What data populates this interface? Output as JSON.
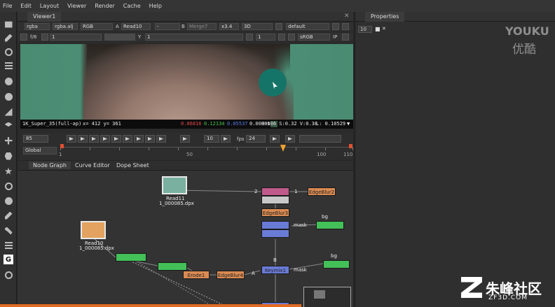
{
  "menu": [
    "File",
    "Edit",
    "Layout",
    "Viewer",
    "Render",
    "Cache",
    "Help"
  ],
  "viewer": {
    "tab": "Viewer1",
    "row1": {
      "channels": "rgba",
      "alpha": "rgba.alj",
      "colorspace": "RGB",
      "a_label": "A",
      "a_input": "Read10",
      "dash": "-",
      "b_label": "B",
      "b_input": "Merge7",
      "zoom": "x3.4",
      "mode": "3D",
      "lut": "default"
    },
    "row2": {
      "fstop": "f/8",
      "gain": "1",
      "y_label": "Y",
      "gamma": "1",
      "frame": "1",
      "display": "sRGB",
      "ip": "IP"
    },
    "info": {
      "format": "1K_Super_35(full-ap)",
      "coords": "x= 412 y= 361",
      "r": "0.06816",
      "g": "0.12134",
      "b": "0.05537",
      "a": "0.00000",
      "hsv": "H:106 S:0.32 V:0.38",
      "lum": "L: 0.10529"
    },
    "timeline": {
      "frame": "85",
      "step": "10",
      "fps_label": "fps",
      "fps": "24",
      "scope": "Global",
      "ruler": [
        "1",
        "50",
        "100",
        "110"
      ],
      "range_end": "110"
    }
  },
  "properties": {
    "tab": "Properties",
    "count": "10"
  },
  "nodegraph": {
    "tabs": [
      "Node Graph",
      "Curve Editor",
      "Dope Sheet"
    ],
    "read11": {
      "label": "Read11",
      "file": "1_000085.dpx"
    },
    "read10": {
      "label": "Read10",
      "file": "1_000085.dpx"
    },
    "nodes": {
      "edgeblur2": "EdgeBlur2",
      "edgeblur3": "EdgeBlur3",
      "erode1": "Erode1",
      "edgeblur4": "EdgeBlur4",
      "keymix1": "Keymix1",
      "mask_label1": "mask",
      "mask_label2": "mask",
      "bg_label1": "bg",
      "bg_label2": "bg",
      "a_label": "A",
      "b_label": "B",
      "port2": "2",
      "port1": "1"
    }
  },
  "watermark": {
    "youku": "YOUKU",
    "youku_cn": "优酷",
    "site": "朱峰社区",
    "site_url": "ZF3D.COM"
  }
}
